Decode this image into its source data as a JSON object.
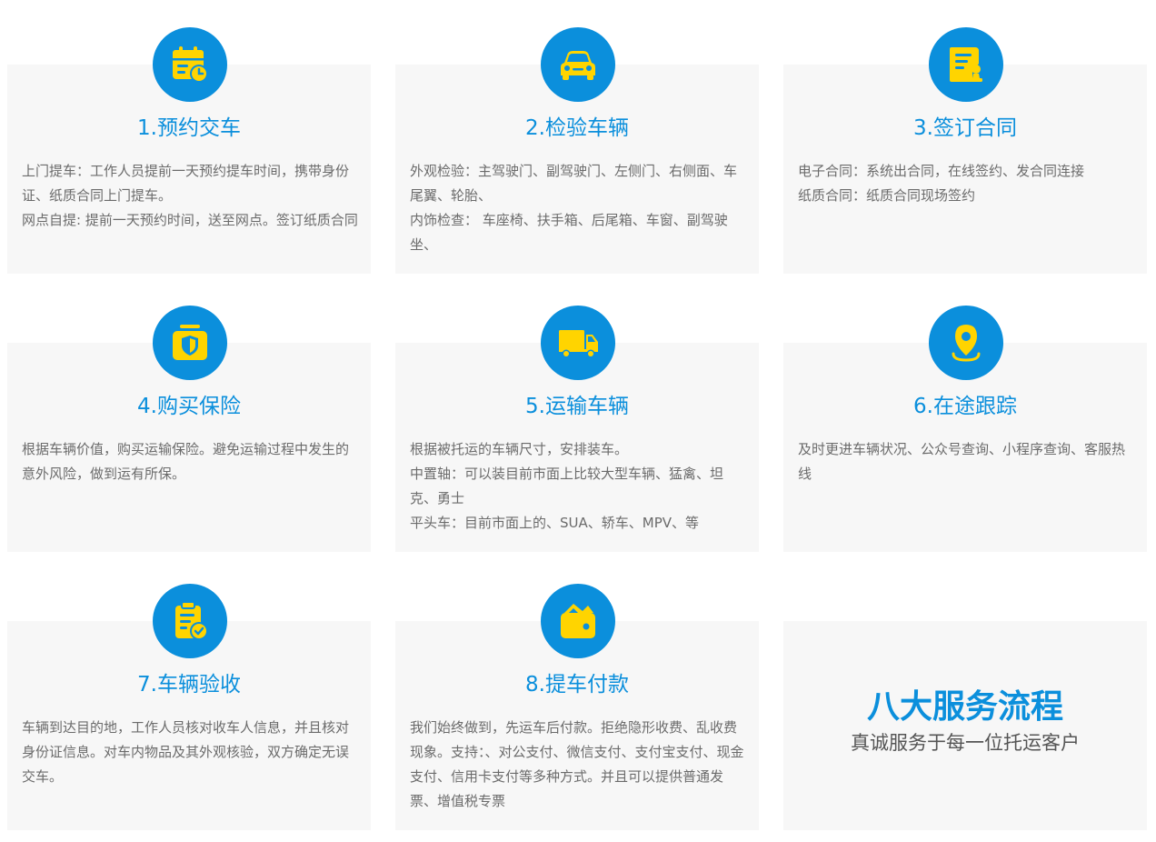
{
  "colors": {
    "accent": "#0b8fdc",
    "icon": "#ffd400",
    "card_bg": "#f7f7f7",
    "desc_text": "#6b6b6b"
  },
  "steps": [
    {
      "icon": "calendar-clock-icon",
      "title": "1.预约交车",
      "lines": [
        "上门提车：工作人员提前一天预约提车时间，携带身份证、纸质合同上门提车。",
        "网点自提: 提前一天预约时间，送至网点。签订纸质合同"
      ]
    },
    {
      "icon": "car-icon",
      "title": "2.检验车辆",
      "lines": [
        "外观检验：主驾驶门、副驾驶门、左侧门、右侧面、车尾翼、轮胎、",
        "内饰检查： 车座椅、扶手箱、后尾箱、车窗、副驾驶坐、"
      ]
    },
    {
      "icon": "contract-seal-icon",
      "title": "3.签订合同",
      "lines": [
        "电子合同：系统出合同，在线签约、发合同连接",
        "纸质合同：纸质合同现场签约"
      ]
    },
    {
      "icon": "insurance-shield-icon",
      "title": "4.购买保险",
      "lines": [
        "根据车辆价值，购买运输保险。避免运输过程中发生的意外风险，做到运有所保。"
      ]
    },
    {
      "icon": "truck-icon",
      "title": "5.运输车辆",
      "lines": [
        "根据被托运的车辆尺寸，安排装车。",
        "中置轴：可以装目前市面上比较大型车辆、猛禽、坦克、勇士",
        "平头车：目前市面上的、SUA、轿车、MPV、等"
      ]
    },
    {
      "icon": "location-pin-icon",
      "title": "6.在途跟踪",
      "lines": [
        "及时更进车辆状况、公众号查询、小程序查询、客服热线"
      ]
    },
    {
      "icon": "clipboard-check-icon",
      "title": "7.车辆验收",
      "lines": [
        "车辆到达目的地，工作人员核对收车人信息，并且核对身份证信息。对车内物品及其外观核验，双方确定无误交车。"
      ]
    },
    {
      "icon": "wallet-icon",
      "title": "8.提车付款",
      "lines": [
        "我们始终做到，先运车后付款。拒绝隐形收费、乱收费现象。支持：、对公支付、微信支付、支付宝支付、现金支付、信用卡支付等多种方式。并且可以提供普通发票、增值税专票"
      ]
    }
  ],
  "summary": {
    "title": "八大服务流程",
    "subtitle": "真诚服务于每一位托运客户"
  }
}
